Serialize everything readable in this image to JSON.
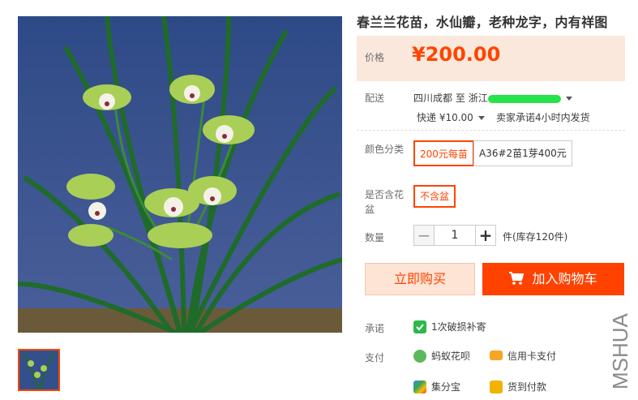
{
  "product": {
    "title": "春兰兰花苗，水仙瓣，老种龙字，内有祥图",
    "price_label": "价格",
    "price": "¥200.00"
  },
  "delivery": {
    "label": "配送",
    "from": "四川成都",
    "to_word": "至",
    "to": "浙江",
    "shipping": "快递 ¥10.00",
    "promise": "卖家承诺4小时内发货"
  },
  "sku": {
    "color_label": "颜色分类",
    "options": [
      "200元每苗",
      "A36#2苗1芽400元"
    ],
    "pot_label_1": "是否含花",
    "pot_label_2": "盆",
    "pot_option": "不含盆"
  },
  "quantity": {
    "label": "数量",
    "minus": "−",
    "value": "1",
    "plus": "+",
    "stock": "件(库存120件)"
  },
  "actions": {
    "buy_now": "立即购买",
    "add_to_cart": "加入购物车"
  },
  "service": {
    "promise_label": "承诺",
    "promise_text": "1次破损补寄",
    "pay_label": "支付",
    "pay_methods": [
      "蚂蚁花呗",
      "信用卡支付",
      "集分宝",
      "货到付款"
    ]
  },
  "watermark": "MSHUA",
  "colors": {
    "accent": "#ff4400",
    "price_bg": "#fbe8dc"
  }
}
